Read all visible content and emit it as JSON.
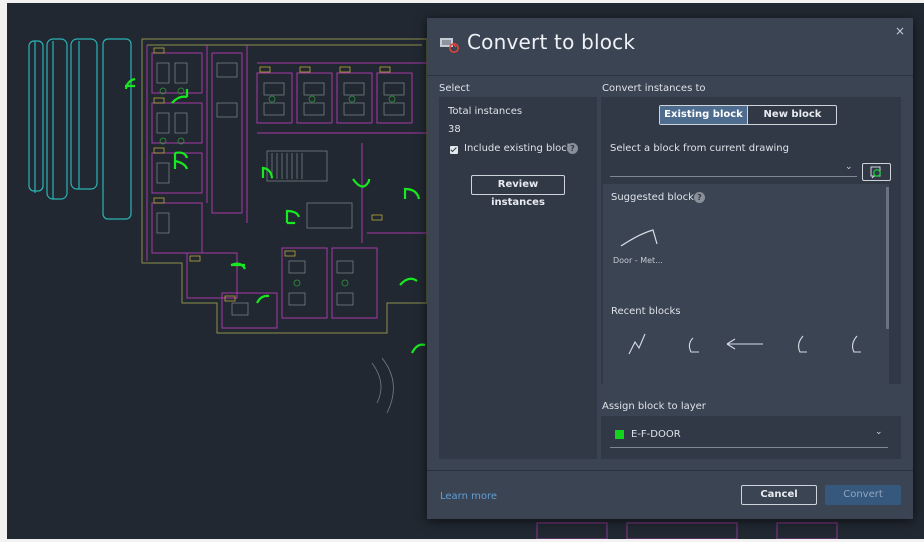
{
  "dialog": {
    "title": "Convert to block",
    "close_glyph": "×",
    "icons": {
      "title": "convert-block-icon",
      "close": "close-icon"
    }
  },
  "select": {
    "section_label": "Select",
    "total_label": "Total instances",
    "total_value": "38",
    "include_existing_label": "Include existing blocks",
    "include_existing_checked": true,
    "help_glyph": "?",
    "review_button": "Review instances"
  },
  "convert_to": {
    "section_label": "Convert instances to",
    "tabs": [
      {
        "label": "Existing block",
        "active": true
      },
      {
        "label": "New block",
        "active": false
      }
    ],
    "select_block_label": "Select a block from current drawing",
    "select_block_value": "",
    "suggested_label": "Suggested blocks",
    "suggested_blocks": [
      {
        "label": "Door - Met...",
        "icon": "door-arc-thumbnail-icon"
      }
    ],
    "recent_label": "Recent blocks",
    "recent_blocks": [
      {
        "icon": "zigzag-thumbnail-icon"
      },
      {
        "icon": "door-swing-thumbnail-icon"
      },
      {
        "icon": "arrow-thumbnail-icon"
      },
      {
        "icon": "door-swing-thumbnail-icon"
      },
      {
        "icon": "door-swing-thumbnail-icon"
      }
    ]
  },
  "assign_layer": {
    "label": "Assign block to layer",
    "layer_name": "E-F-DOOR",
    "layer_color": "#12d41c"
  },
  "footer": {
    "learn_more": "Learn more",
    "cancel": "Cancel",
    "convert": "Convert"
  },
  "colors": {
    "dialog_bg": "#3b4453",
    "panel_bg": "#313946",
    "accent": "#4d6c8e",
    "link": "#5f9fd4",
    "canvas_bg": "#212831"
  }
}
